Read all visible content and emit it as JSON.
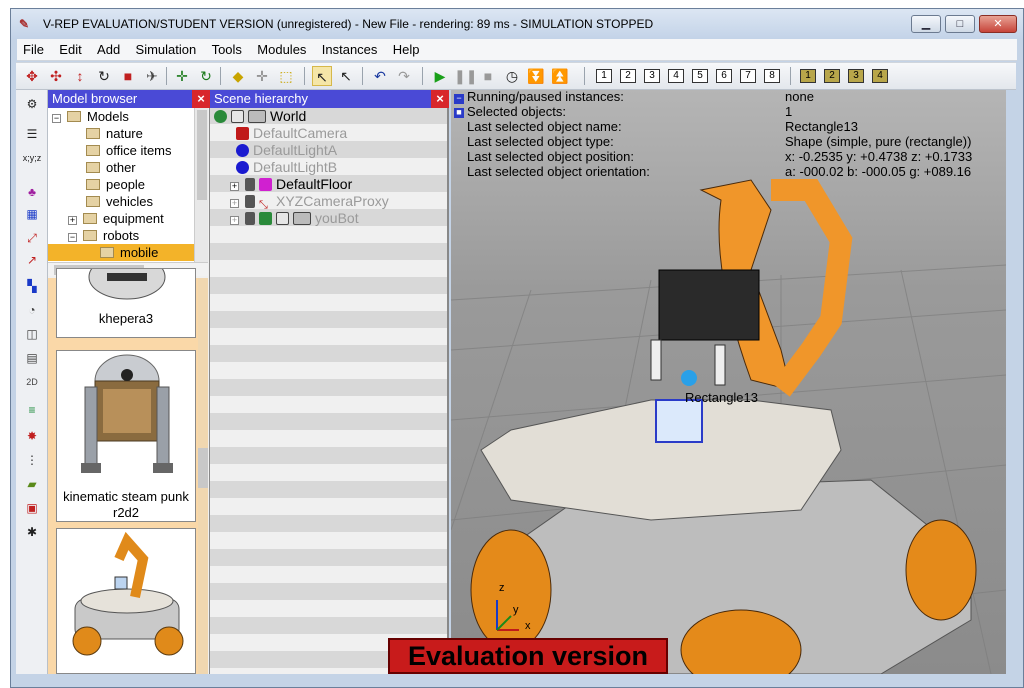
{
  "window": {
    "title": "V-REP EVALUATION/STUDENT VERSION (unregistered) - New File - rendering: 89 ms - SIMULATION STOPPED",
    "minimize": "▁",
    "maximize": "□",
    "close": "✕"
  },
  "menu": [
    "File",
    "Edit",
    "Add",
    "Simulation",
    "Tools",
    "Modules",
    "Instances",
    "Help"
  ],
  "toolbar": {
    "scene_numbers": [
      "1",
      "2",
      "3",
      "4",
      "5",
      "6",
      "7",
      "8"
    ],
    "page_numbers": [
      "1",
      "2",
      "3",
      "4"
    ]
  },
  "model_browser": {
    "title": "Model browser",
    "tree": [
      {
        "label": "Models",
        "expander": "−",
        "depth": 0
      },
      {
        "label": "nature",
        "expander": "",
        "depth": 1
      },
      {
        "label": "office items",
        "expander": "",
        "depth": 1
      },
      {
        "label": "other",
        "expander": "",
        "depth": 1
      },
      {
        "label": "people",
        "expander": "",
        "depth": 1
      },
      {
        "label": "vehicles",
        "expander": "",
        "depth": 1
      },
      {
        "label": "equipment",
        "expander": "+",
        "depth": 1
      },
      {
        "label": "robots",
        "expander": "−",
        "depth": 1
      },
      {
        "label": "mobile",
        "expander": "",
        "depth": 2,
        "selected": true
      }
    ],
    "thumbnails": [
      {
        "label": "khepera3"
      },
      {
        "label": "kinematic steam punk r2d2"
      },
      {
        "label": ""
      }
    ]
  },
  "scene_hierarchy": {
    "title": "Scene hierarchy",
    "items": [
      {
        "label": "World",
        "muted": false
      },
      {
        "label": "DefaultCamera",
        "muted": true
      },
      {
        "label": "DefaultLightA",
        "muted": true
      },
      {
        "label": "DefaultLightB",
        "muted": true
      },
      {
        "label": "DefaultFloor",
        "muted": false
      },
      {
        "label": "XYZCameraProxy",
        "muted": true
      },
      {
        "label": "youBot",
        "muted": true
      }
    ]
  },
  "viewport": {
    "info": [
      {
        "key": "Running/paused instances:",
        "value": "none"
      },
      {
        "key": "Selected objects:",
        "value": "1"
      },
      {
        "key": "Last selected object name:",
        "value": "Rectangle13"
      },
      {
        "key": "Last selected object type:",
        "value": "Shape (simple, pure (rectangle))"
      },
      {
        "key": "Last selected object position:",
        "value": "x: -0.2535    y: +0.4738    z: +0.1733"
      },
      {
        "key": "Last selected object orientation:",
        "value": "a: -000.02    b: -000.05    g: +089.16"
      }
    ],
    "object_label": "Rectangle13",
    "axis_labels": [
      "z",
      "y",
      "x"
    ],
    "eval_banner": "Evaluation version"
  }
}
